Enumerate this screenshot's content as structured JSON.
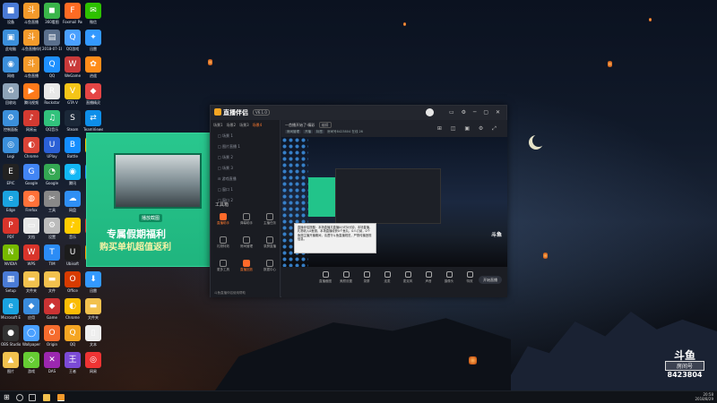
{
  "desktop": {
    "icons": [
      {
        "label": "设备",
        "color": "#4a7bd6",
        "glyph": "■",
        "col": 0,
        "row": 0
      },
      {
        "label": "斗鱼直播",
        "color": "#f39a2b",
        "glyph": "斗",
        "col": 1,
        "row": 0
      },
      {
        "label": "360看图",
        "color": "#3ab54a",
        "glyph": "◼",
        "col": 2,
        "row": 0
      },
      {
        "label": "Foxmail Party",
        "color": "#ff6b24",
        "glyph": "F",
        "col": 3,
        "row": 0
      },
      {
        "label": "微信",
        "color": "#2dc100",
        "glyph": "✉",
        "col": 4,
        "row": 0
      },
      {
        "label": "此电脑",
        "color": "#3b8fdb",
        "glyph": "▣",
        "col": 0,
        "row": 1
      },
      {
        "label": "斗鱼直播伴侣",
        "color": "#f39a2b",
        "glyph": "斗",
        "col": 1,
        "row": 1
      },
      {
        "label": "2018-07-10",
        "color": "#5a6f8c",
        "glyph": "▤",
        "col": 2,
        "row": 1
      },
      {
        "label": "QQ游戏",
        "color": "#4aa0ff",
        "glyph": "Q",
        "col": 3,
        "row": 1
      },
      {
        "label": "迅雷",
        "color": "#3399ff",
        "glyph": "✦",
        "col": 4,
        "row": 1
      },
      {
        "label": "网络",
        "color": "#3b8fdb",
        "glyph": "◉",
        "col": 0,
        "row": 2
      },
      {
        "label": "斗鱼直播",
        "color": "#f39a2b",
        "glyph": "斗",
        "col": 1,
        "row": 2
      },
      {
        "label": "QQ",
        "color": "#1e90ff",
        "glyph": "Q",
        "col": 2,
        "row": 2
      },
      {
        "label": "WeGame",
        "color": "#c93a3a",
        "glyph": "W",
        "col": 3,
        "row": 2
      },
      {
        "label": "逍遥",
        "color": "#ff8c1a",
        "glyph": "✿",
        "col": 4,
        "row": 2
      },
      {
        "label": "回收站",
        "color": "#8da3b8",
        "glyph": "♻",
        "col": 0,
        "row": 3
      },
      {
        "label": "腾讯视频",
        "color": "#ff7a1a",
        "glyph": "▶",
        "col": 1,
        "row": 3
      },
      {
        "label": "Rockstar",
        "color": "#e8e8e8",
        "glyph": "R",
        "col": 2,
        "row": 3
      },
      {
        "label": "GTA V",
        "color": "#f5c518",
        "glyph": "V",
        "col": 3,
        "row": 3
      },
      {
        "label": "直播精灵",
        "color": "#e54545",
        "glyph": "◆",
        "col": 4,
        "row": 3
      },
      {
        "label": "控制面板",
        "color": "#3b8fdb",
        "glyph": "⚙",
        "col": 0,
        "row": 4
      },
      {
        "label": "网易云",
        "color": "#d33a31",
        "glyph": "♪",
        "col": 1,
        "row": 4
      },
      {
        "label": "QQ音乐",
        "color": "#31c27c",
        "glyph": "♫",
        "col": 2,
        "row": 4
      },
      {
        "label": "Steam",
        "color": "#1b2838",
        "glyph": "S",
        "col": 3,
        "row": 4
      },
      {
        "label": "TeamViewer",
        "color": "#0e8ee9",
        "glyph": "⇄",
        "col": 4,
        "row": 4
      },
      {
        "label": "Logi",
        "color": "#3b8fdb",
        "glyph": "◎",
        "col": 0,
        "row": 5
      },
      {
        "label": "EPIC",
        "color": "#222",
        "glyph": "E",
        "col": 0,
        "row": 6
      },
      {
        "label": "Edge",
        "color": "#1aa3e0",
        "glyph": "e",
        "col": 0,
        "row": 7
      },
      {
        "label": "PDF",
        "color": "#d9342b",
        "glyph": "P",
        "col": 0,
        "row": 8
      },
      {
        "label": "NVIDIA",
        "color": "#76b900",
        "glyph": "N",
        "col": 0,
        "row": 9
      },
      {
        "label": "Setup",
        "color": "#4a7bd6",
        "glyph": "▦",
        "col": 0,
        "row": 10
      },
      {
        "label": "Microsoft Edge",
        "color": "#1aa3e0",
        "glyph": "e",
        "col": 0,
        "row": 11
      },
      {
        "label": "OBS Studio",
        "color": "#333",
        "glyph": "●",
        "col": 0,
        "row": 12
      },
      {
        "label": "图片",
        "color": "#f2c14e",
        "glyph": "▲",
        "col": 0,
        "row": 13
      },
      {
        "label": "Chrome",
        "color": "#db4437",
        "glyph": "◐",
        "col": 1,
        "row": 5
      },
      {
        "label": "Google",
        "color": "#4285f4",
        "glyph": "G",
        "col": 1,
        "row": 6
      },
      {
        "label": "Firefox",
        "color": "#ff7139",
        "glyph": "◍",
        "col": 1,
        "row": 7
      },
      {
        "label": "文档",
        "color": "#e8e8e8",
        "glyph": "▭",
        "col": 1,
        "row": 8
      },
      {
        "label": "WPS",
        "color": "#d9342b",
        "glyph": "W",
        "col": 1,
        "row": 9
      },
      {
        "label": "文件夹",
        "color": "#f2c14e",
        "glyph": "▬",
        "col": 1,
        "row": 10
      },
      {
        "label": "应用",
        "color": "#3a8bdc",
        "glyph": "◆",
        "col": 1,
        "row": 11
      },
      {
        "label": "Wallpaper",
        "color": "#4aa0ff",
        "glyph": "◯",
        "col": 1,
        "row": 12
      },
      {
        "label": "游戏",
        "color": "#6c3",
        "glyph": "◇",
        "col": 1,
        "row": 13
      },
      {
        "label": "UPlay",
        "color": "#2a60d6",
        "glyph": "U",
        "col": 2,
        "row": 5
      },
      {
        "label": "Google",
        "color": "#34a853",
        "glyph": "◔",
        "col": 2,
        "row": 6
      },
      {
        "label": "工具",
        "color": "#888",
        "glyph": "✂",
        "col": 2,
        "row": 7
      },
      {
        "label": "设置",
        "color": "#bbb",
        "glyph": "⚙",
        "col": 2,
        "row": 8
      },
      {
        "label": "TIM",
        "color": "#2b8cf6",
        "glyph": "T",
        "col": 2,
        "row": 9
      },
      {
        "label": "文件",
        "color": "#f2c14e",
        "glyph": "▬",
        "col": 2,
        "row": 10
      },
      {
        "label": "Game",
        "color": "#c33",
        "glyph": "◆",
        "col": 2,
        "row": 11
      },
      {
        "label": "Origin",
        "color": "#f56c2d",
        "glyph": "O",
        "col": 2,
        "row": 12
      },
      {
        "label": "DAS",
        "color": "#9c27b0",
        "glyph": "✕",
        "col": 2,
        "row": 13
      },
      {
        "label": "Battle",
        "color": "#148eff",
        "glyph": "B",
        "col": 3,
        "row": 5
      },
      {
        "label": "腾讯",
        "color": "#12b7f5",
        "glyph": "◉",
        "col": 3,
        "row": 6
      },
      {
        "label": "网盘",
        "color": "#2f8ff5",
        "glyph": "☁",
        "col": 3,
        "row": 7
      },
      {
        "label": "音乐",
        "color": "#ffcc00",
        "glyph": "♪",
        "col": 3,
        "row": 8
      },
      {
        "label": "Ubisoft",
        "color": "#1c1c1c",
        "glyph": "U",
        "col": 3,
        "row": 9
      },
      {
        "label": "Office",
        "color": "#d83b01",
        "glyph": "O",
        "col": 3,
        "row": 10
      },
      {
        "label": "Chrome",
        "color": "#fbbc05",
        "glyph": "◐",
        "col": 3,
        "row": 11
      },
      {
        "label": "QQ",
        "color": "#f5a623",
        "glyph": "Q",
        "col": 3,
        "row": 12
      },
      {
        "label": "王者",
        "color": "#7b4ad6",
        "glyph": "王",
        "col": 3,
        "row": 13
      },
      {
        "label": "YY",
        "color": "#f7c600",
        "glyph": "Y",
        "col": 4,
        "row": 5
      },
      {
        "label": "钉钉",
        "color": "#1e90ff",
        "glyph": "⊙",
        "col": 4,
        "row": 6
      },
      {
        "label": "企业",
        "color": "#d9342b",
        "glyph": "✕",
        "col": 4,
        "row": 8
      },
      {
        "label": "虎牙",
        "color": "#ff9900",
        "glyph": "◈",
        "col": 4,
        "row": 9
      },
      {
        "label": "迅雷",
        "color": "#3399ff",
        "glyph": "⬇",
        "col": 4,
        "row": 10
      },
      {
        "label": "文件夹",
        "color": "#f2c14e",
        "glyph": "▬",
        "col": 4,
        "row": 11
      },
      {
        "label": "文本",
        "color": "#eee",
        "glyph": "▯",
        "col": 4,
        "row": 12
      },
      {
        "label": "网易",
        "color": "#e33",
        "glyph": "◎",
        "col": 4,
        "row": 13
      }
    ]
  },
  "ad_banner": {
    "tag": "播放截图",
    "line1": "专属假期福利",
    "line2": "购买单机超值返利"
  },
  "window": {
    "logo": "直播伴侣",
    "version": "V6.1.0",
    "tabs": [
      "场景1",
      "场景2",
      "场景3",
      "场景4"
    ],
    "scenes": [
      "□ 场景 1",
      "□ 图片直播 1",
      "□ 场景 2",
      "□ 场景 3",
      "⊟ 游戏直播",
      "□ 窗口 1",
      "□ 窗口 2"
    ],
    "toolbox_title": "工具箱",
    "tools": [
      {
        "label": "直播助手",
        "hot": true
      },
      {
        "label": "弹幕助手",
        "hot": false
      },
      {
        "label": "主播任务",
        "hot": false
      },
      {
        "label": "礼物特效",
        "hot": false
      },
      {
        "label": "房间管理",
        "hot": false
      },
      {
        "label": "录屏直播",
        "hot": false
      },
      {
        "label": "更多工具",
        "hot": false
      },
      {
        "label": "直播回放",
        "hot": true
      },
      {
        "label": "数据中心",
        "hot": false
      }
    ],
    "sidebar_footer": "斗鱼直播伴侣使用帮助",
    "main_title": "—首播开始了·精彩",
    "main_pill": "编辑",
    "chips": [
      "房间管理",
      "开播",
      "标签"
    ],
    "room_info": "房间号8423804  在线 26",
    "notice_text": "直播伴侣提醒：本场直播共直播0小时0分钟，本场直播，礼物收入0鱼翅，本场直播收获0个鱼丸，0人订阅，0个鱼翅主播开播期间，请遵守斗鱼直播规范，严禁传播违规信息。",
    "controls": [
      "直播截图",
      "美颜设置",
      "录屏",
      "连麦",
      "麦克风",
      "声音",
      "摄像头",
      "特效"
    ],
    "start_label": "开始直播"
  },
  "watermark": {
    "brand": "斗鱼",
    "room_label": "房间号",
    "room_number": "8423804"
  },
  "taskbar": {
    "time": "20:58",
    "date": "2018/8/29"
  }
}
